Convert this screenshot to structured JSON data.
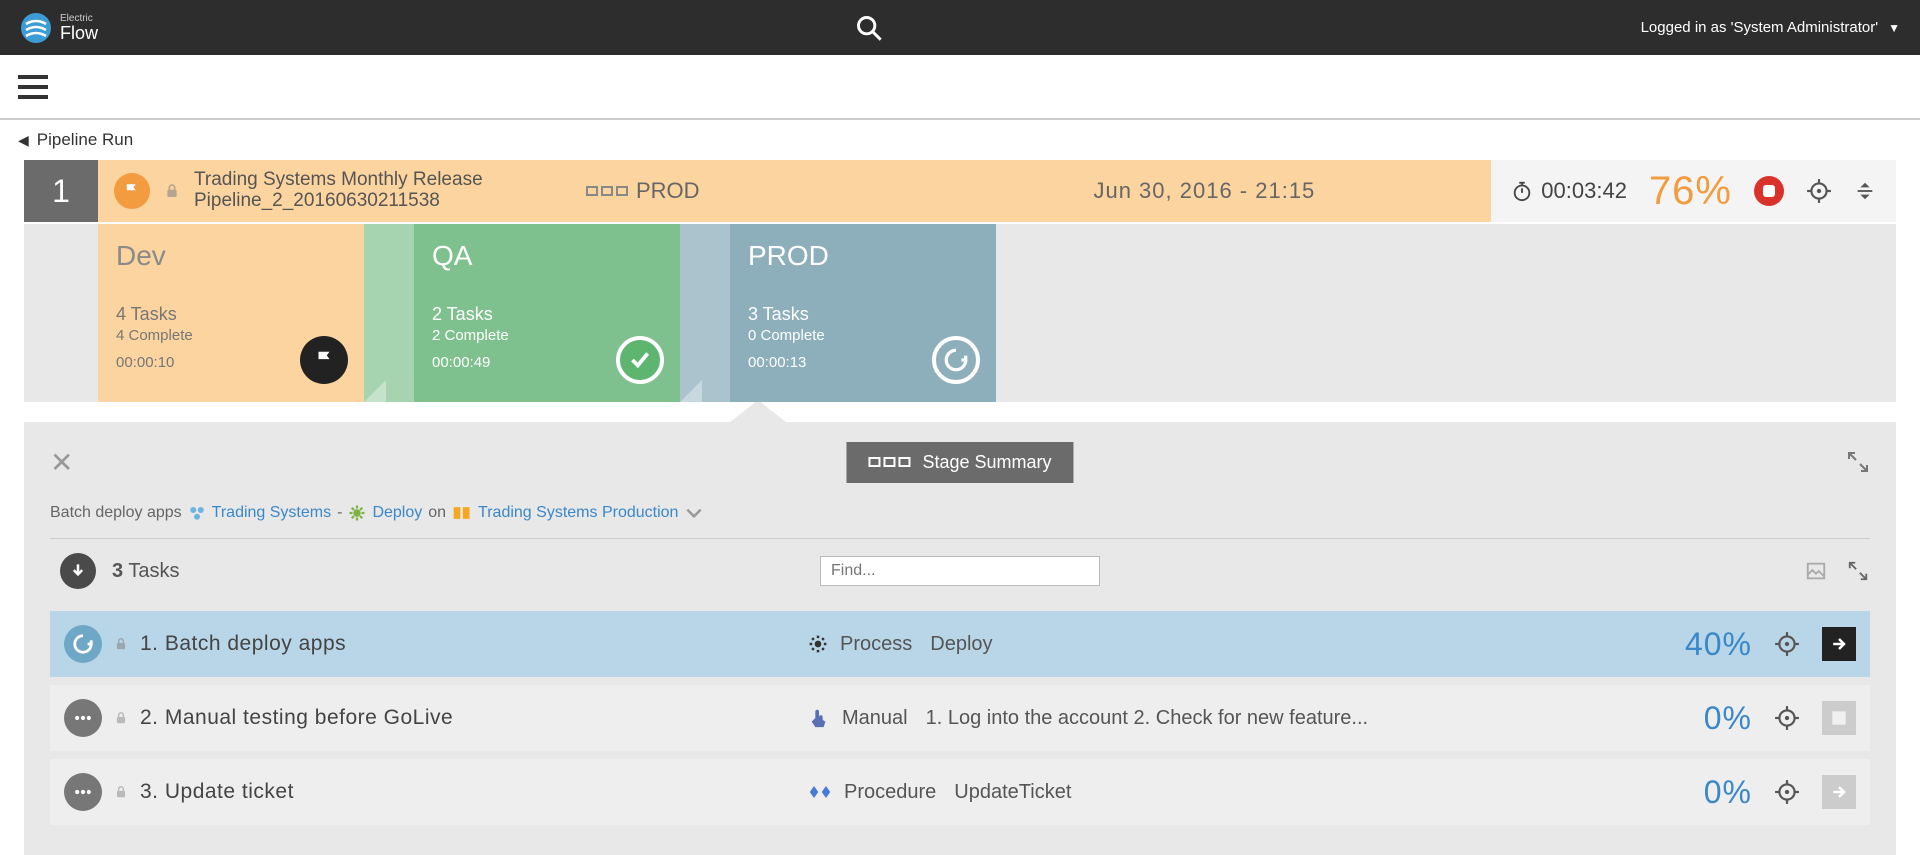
{
  "header": {
    "brand_top": "Electric",
    "brand_bottom": "Flow",
    "user_text": "Logged in as 'System Administrator'"
  },
  "breadcrumb": {
    "label": "Pipeline Run"
  },
  "pipeline": {
    "index": "1",
    "title": "Trading Systems Monthly Release Pipeline_2_20160630211538",
    "current_stage": "PROD",
    "datetime": "Jun 30, 2016 - 21:15",
    "elapsed": "00:03:42",
    "percent": "76%"
  },
  "stages": [
    {
      "name": "Dev",
      "tasks": "4 Tasks",
      "complete": "4 Complete",
      "time": "00:00:10",
      "status": "flag"
    },
    {
      "name": "QA",
      "tasks": "2 Tasks",
      "complete": "2 Complete",
      "time": "00:00:49",
      "status": "check"
    },
    {
      "name": "PROD",
      "tasks": "3 Tasks",
      "complete": "0 Complete",
      "time": "00:00:13",
      "status": "running"
    }
  ],
  "summary": {
    "badge": "Stage Summary",
    "prefix": "Batch deploy apps",
    "app_link": "Trading Systems",
    "sep1": "-",
    "deploy_link": "Deploy",
    "on_text": "on",
    "env_link": "Trading Systems Production"
  },
  "tasks_header": {
    "count_label": "3",
    "tasks_word": "Tasks",
    "find_placeholder": "Find..."
  },
  "tasks": [
    {
      "num_name": "1. Batch deploy apps",
      "type": "Process",
      "detail": "Deploy",
      "percent": "40%",
      "status": "running",
      "go": "dark",
      "type_icon": "gear"
    },
    {
      "num_name": "2. Manual testing before GoLive",
      "type": "Manual",
      "detail": "1. Log into the account 2. Check for new feature...",
      "percent": "0%",
      "status": "pending",
      "go": "light",
      "type_icon": "hand"
    },
    {
      "num_name": "3. Update ticket",
      "type": "Procedure",
      "detail": "UpdateTicket",
      "percent": "0%",
      "status": "pending",
      "go": "light",
      "type_icon": "diamond"
    }
  ]
}
